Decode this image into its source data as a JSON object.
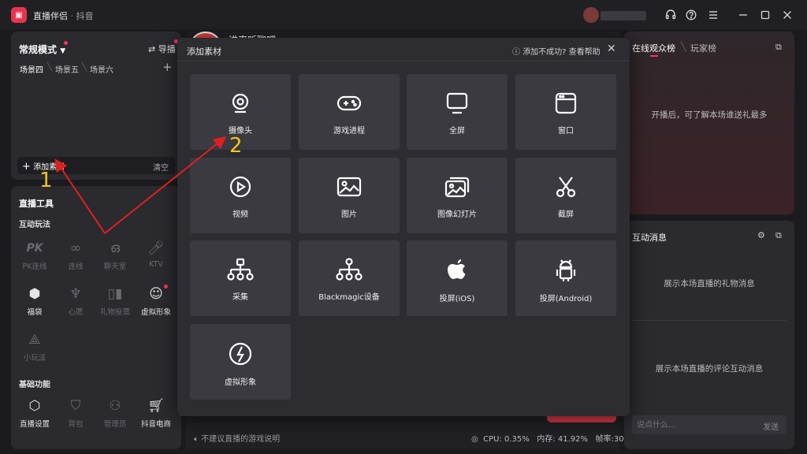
{
  "titlebar": {
    "app_name": "直播伴侣",
    "separator": "·",
    "platform": "抖音"
  },
  "scene_panel": {
    "mode_label": "常规模式",
    "import_label": "导播",
    "tabs": [
      {
        "label": "场景四"
      },
      {
        "label": "场景五"
      },
      {
        "label": "场景六"
      }
    ],
    "add_material": "添加素材",
    "clear": "清空"
  },
  "tools_panel": {
    "title": "直播工具",
    "interactive_title": "互动玩法",
    "interactive": [
      {
        "label": "PK连线",
        "icon": "pk-icon"
      },
      {
        "label": "连线",
        "icon": "link-icon"
      },
      {
        "label": "聊天室",
        "icon": "chatroom-icon"
      },
      {
        "label": "KTV",
        "icon": "mic-icon"
      },
      {
        "label": "福袋",
        "icon": "lucky-bag-icon"
      },
      {
        "label": "心愿",
        "icon": "wish-icon"
      },
      {
        "label": "礼物投票",
        "icon": "vote-icon"
      },
      {
        "label": "虚拟形象",
        "icon": "avatar-icon"
      },
      {
        "label": "小玩法",
        "icon": "mini-game-icon"
      }
    ],
    "basic_title": "基础功能",
    "basic": [
      {
        "label": "直播设置",
        "icon": "settings-icon"
      },
      {
        "label": "背包",
        "icon": "backpack-icon"
      },
      {
        "label": "管理员",
        "icon": "admin-icon"
      },
      {
        "label": "抖音电商",
        "icon": "cart-icon"
      }
    ]
  },
  "center": {
    "live_title": "进来听聊吧~",
    "game_tip": "不建议直播的游戏说明",
    "stats": {
      "cpu": "CPU: 0.35%",
      "memory": "内存: 41.92%",
      "fps": "帧率:30"
    }
  },
  "viewers_panel": {
    "tab_viewers": "在线观众榜",
    "tab_players": "玩家榜",
    "empty_text": "开播后，可了解本场谁送礼最多"
  },
  "message_panel": {
    "title": "互动消息",
    "gift_empty": "展示本场直播的礼物消息",
    "comment_empty": "展示本场直播的评论互动消息",
    "input_placeholder": "说点什么...",
    "send": "发送"
  },
  "modal": {
    "title": "添加素材",
    "help": "添加不成功? 查看帮助",
    "tiles": [
      {
        "label": "摄像头",
        "icon": "camera-icon"
      },
      {
        "label": "游戏进程",
        "icon": "gamepad-icon"
      },
      {
        "label": "全屏",
        "icon": "monitor-icon"
      },
      {
        "label": "窗口",
        "icon": "window-icon"
      },
      {
        "label": "视频",
        "icon": "play-icon"
      },
      {
        "label": "图片",
        "icon": "image-icon"
      },
      {
        "label": "图像幻灯片",
        "icon": "slideshow-icon"
      },
      {
        "label": "截屏",
        "icon": "scissors-icon"
      },
      {
        "label": "采集",
        "icon": "capture-icon"
      },
      {
        "label": "Blackmagic设备",
        "icon": "blackmagic-icon"
      },
      {
        "label": "投屏(iOS)",
        "icon": "apple-icon"
      },
      {
        "label": "投屏(Android)",
        "icon": "android-icon"
      },
      {
        "label": "虚拟形象",
        "icon": "virtual-avatar-icon"
      }
    ]
  },
  "annotations": {
    "step1": "1",
    "step2": "2"
  },
  "colors": {
    "accent": "#ff3355",
    "annotation": "#f5c518",
    "arrow": "#e02020"
  }
}
